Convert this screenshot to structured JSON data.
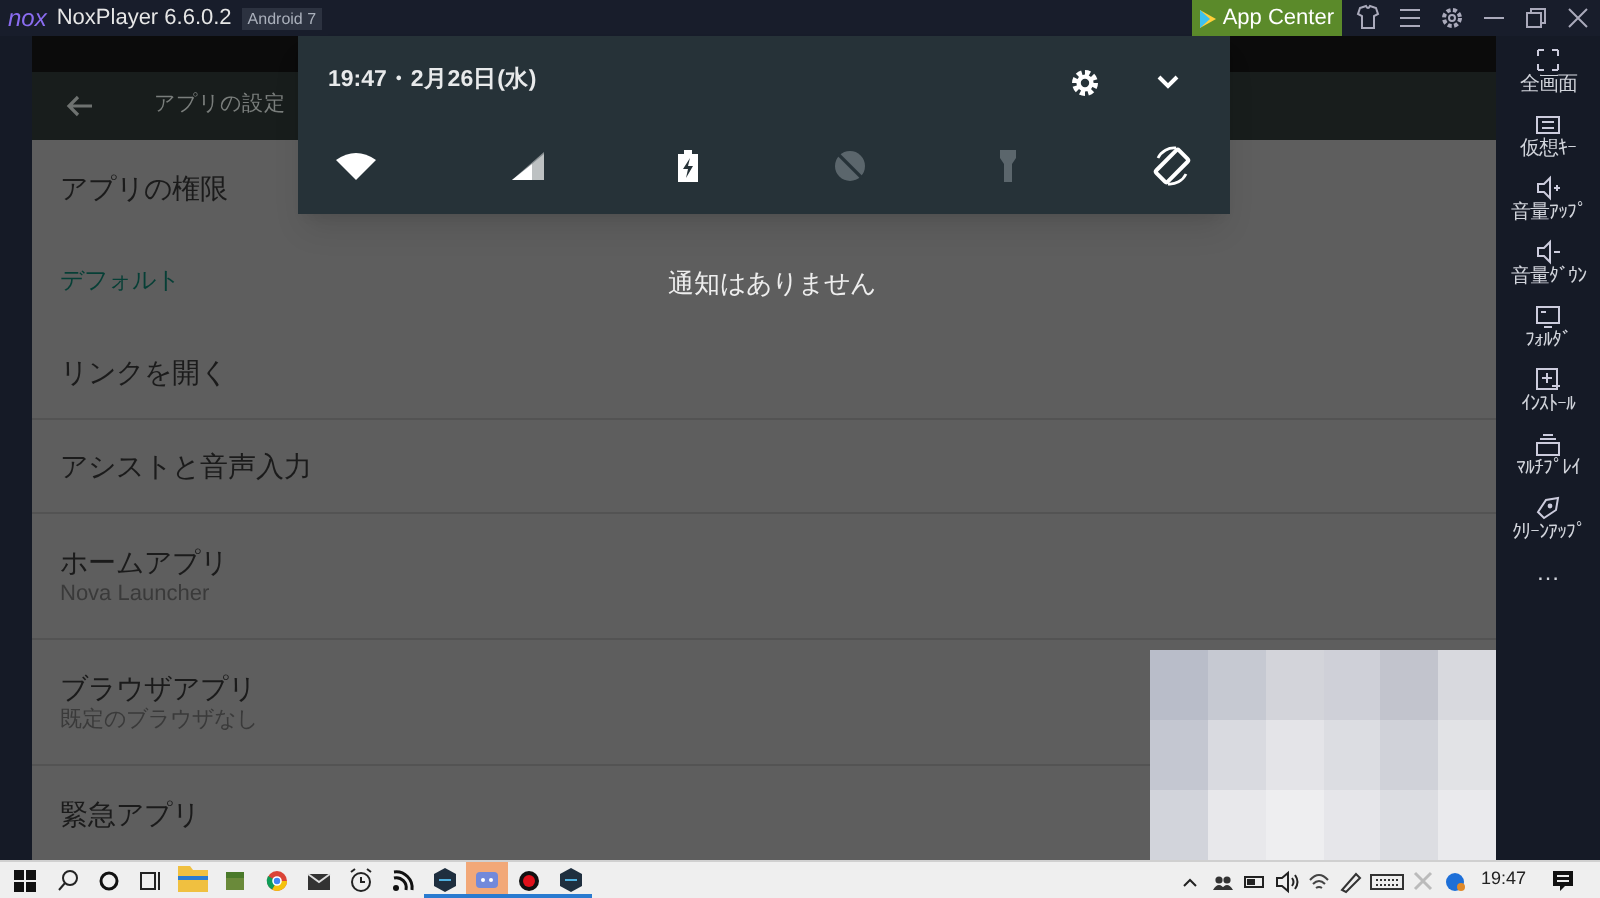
{
  "title_bar": {
    "logo": "nox",
    "title": "NoxPlayer 6.6.0.2",
    "badge": "Android 7",
    "app_center": "App Center",
    "controls": [
      {
        "kind": "skin"
      },
      {
        "kind": "menu"
      },
      {
        "kind": "settings"
      },
      {
        "kind": "minimize"
      },
      {
        "kind": "restore"
      },
      {
        "kind": "close"
      }
    ]
  },
  "toolbar": {
    "title": "アプリの設定"
  },
  "settings_list": [
    {
      "kind": "item",
      "title": "アプリの権限"
    },
    {
      "kind": "category",
      "title": "デフォルト"
    },
    {
      "kind": "item",
      "title": "リンクを開く"
    },
    {
      "kind": "item",
      "title": "アシストと音声入力"
    },
    {
      "kind": "item",
      "title": "ホームアプリ",
      "summary": "Nova Launcher"
    },
    {
      "kind": "item",
      "title": "ブラウザアプリ",
      "summary": "既定のブラウザなし"
    },
    {
      "kind": "item",
      "title": "緊急アプリ"
    }
  ],
  "notification_panel": {
    "datetime": "19:47・2月26日(水)",
    "tiles": [
      {
        "kind": "wifi",
        "on": true
      },
      {
        "kind": "signal",
        "on": true
      },
      {
        "kind": "battery",
        "on": true
      },
      {
        "kind": "data_saver",
        "on": false
      },
      {
        "kind": "flashlight",
        "on": false
      },
      {
        "kind": "rotate",
        "on": true
      }
    ]
  },
  "empty_message": "通知はありません",
  "sidebar": [
    {
      "kind": "fullscreen",
      "label": "全画面"
    },
    {
      "kind": "keyboard",
      "label": "仮想ｷｰ"
    },
    {
      "kind": "volume_up",
      "label": "音量ｱｯﾌﾟ"
    },
    {
      "kind": "volume_down",
      "label": "音量ﾀﾞｳﾝ"
    },
    {
      "kind": "folder",
      "label": "ﾌｫﾙﾀﾞ"
    },
    {
      "kind": "install",
      "label": "ｲﾝｽﾄｰﾙ"
    },
    {
      "kind": "multi",
      "label": "ﾏﾙﾁﾌﾟﾚｲ"
    },
    {
      "kind": "cleanup",
      "label": "ｸﾘｰﾝｱｯﾌﾟ"
    },
    {
      "kind": "more",
      "label": "…"
    }
  ],
  "taskbar": {
    "apps": [
      {
        "kind": "start",
        "running": false,
        "selected": false
      },
      {
        "kind": "search",
        "running": false,
        "selected": false
      },
      {
        "kind": "cortana",
        "running": false,
        "selected": false
      },
      {
        "kind": "taskview",
        "running": false,
        "selected": false
      },
      {
        "kind": "explorer",
        "running": false,
        "selected": false
      },
      {
        "kind": "block",
        "running": false,
        "selected": false
      },
      {
        "kind": "browser",
        "running": false,
        "selected": false
      },
      {
        "kind": "mail",
        "running": false,
        "selected": false
      },
      {
        "kind": "alarm",
        "running": false,
        "selected": false
      },
      {
        "kind": "feed",
        "running": false,
        "selected": false
      },
      {
        "kind": "hex",
        "running": true,
        "selected": false
      },
      {
        "kind": "chat",
        "running": true,
        "selected": true
      },
      {
        "kind": "record",
        "running": true,
        "selected": false
      },
      {
        "kind": "hex",
        "running": true,
        "selected": false
      }
    ],
    "tray": [
      {
        "kind": "chevron"
      },
      {
        "kind": "people"
      },
      {
        "kind": "battery"
      },
      {
        "kind": "volume"
      },
      {
        "kind": "wifi"
      },
      {
        "kind": "pen"
      },
      {
        "kind": "keyboard"
      },
      {
        "kind": "x"
      },
      {
        "kind": "dot"
      }
    ],
    "clock": "19:47"
  }
}
